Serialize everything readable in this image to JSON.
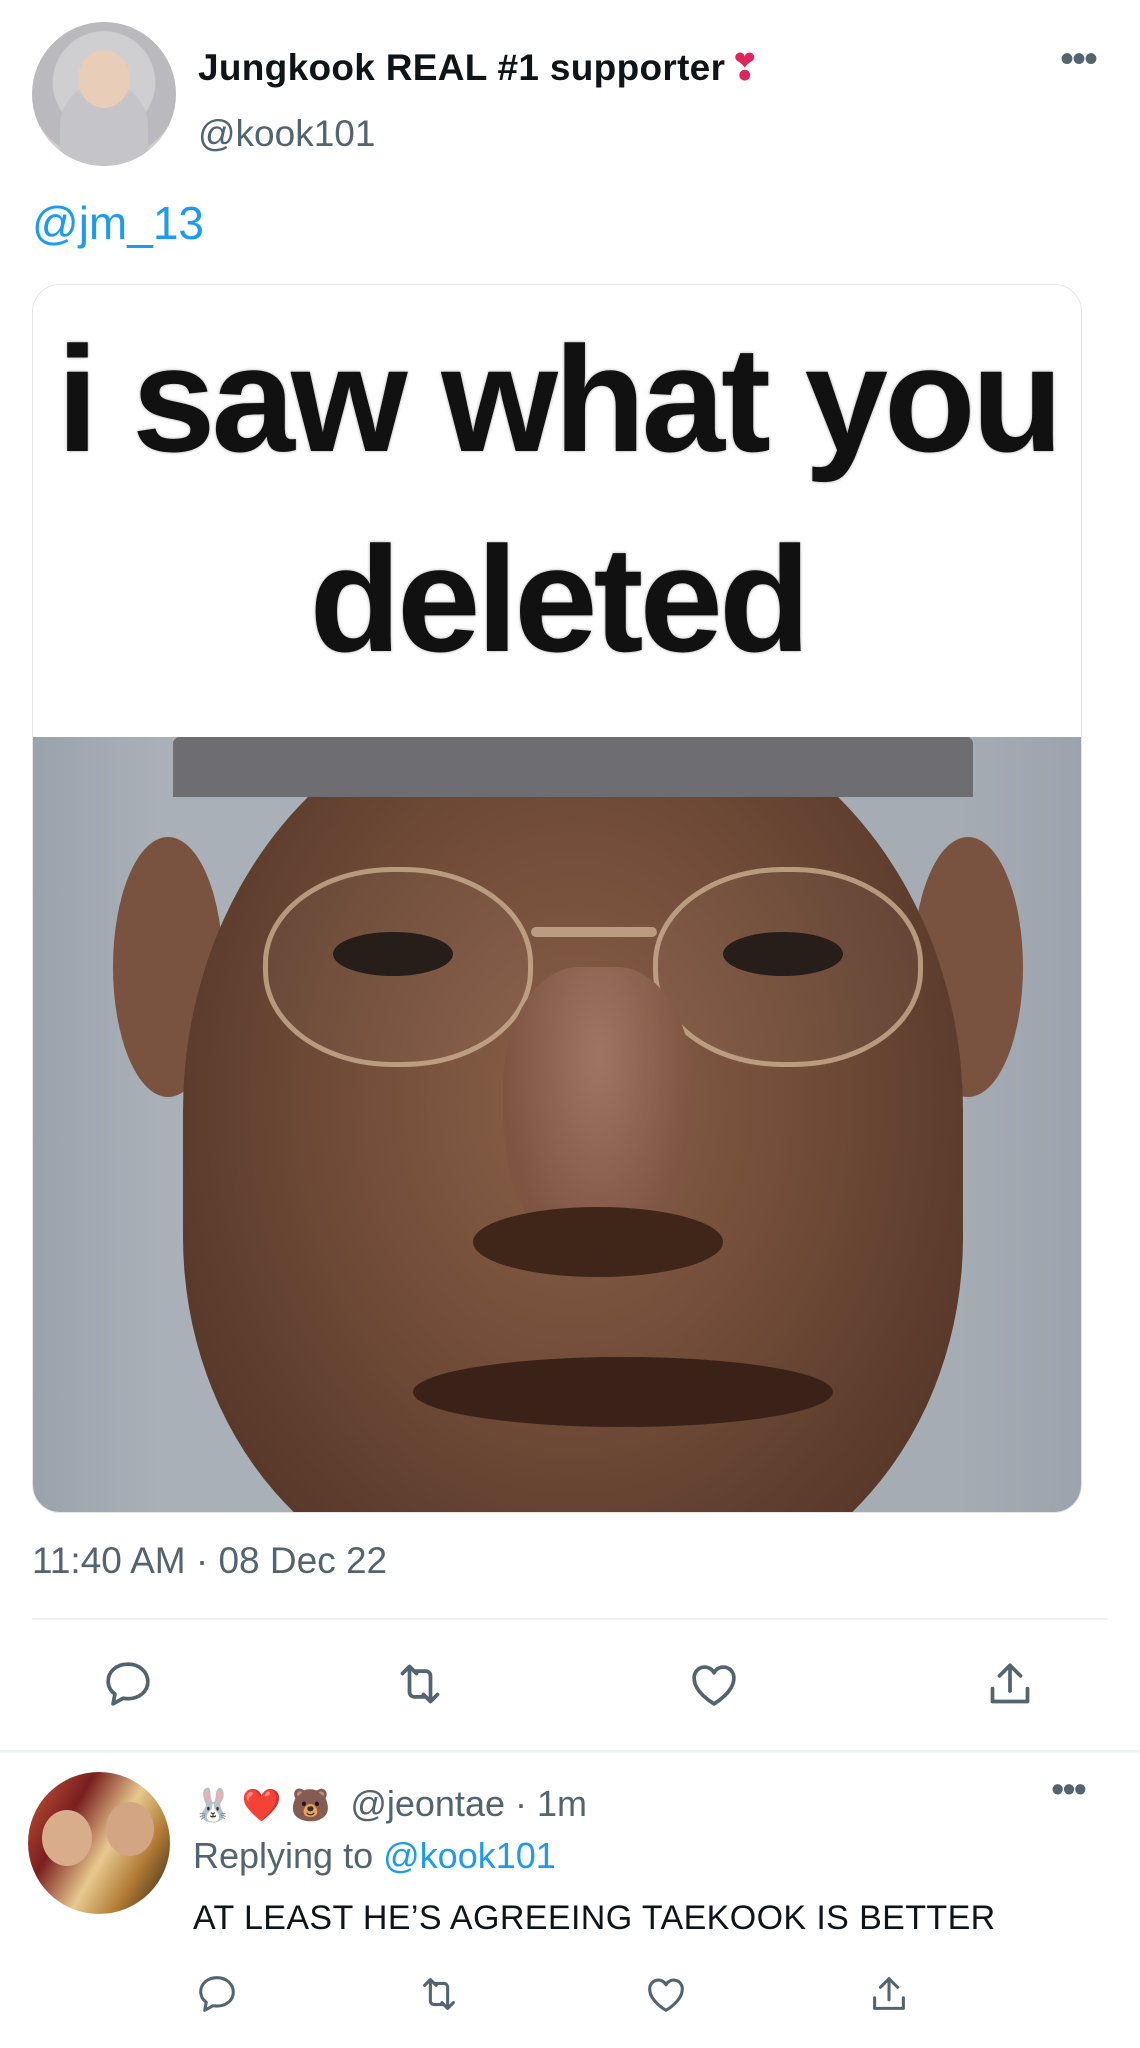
{
  "tweet": {
    "author": {
      "display_name": "Jungkook REAL #1 supporter",
      "name_emoji": "❣",
      "handle": "@kook101"
    },
    "more_icon": "more-horizontal-icon",
    "body_mention": "@jm_13",
    "media": {
      "caption": "i saw what you deleted",
      "caption_line1": "i saw what you",
      "caption_line2": "deleted"
    },
    "timestamp": "11:40 AM · 08 Dec 22",
    "actions": [
      "reply-icon",
      "retweet-icon",
      "like-icon",
      "share-icon"
    ]
  },
  "reply": {
    "author_emoji": "🐰 ❤️ 🐻",
    "handle": "@jeontae",
    "time": "· 1m",
    "replying_prefix": "Replying to",
    "replying_to": "@kook101",
    "text": "AT LEAST HE’S AGREEING TAEKOOK IS BETTER",
    "actions": [
      "reply-icon",
      "retweet-icon",
      "like-icon",
      "share-icon"
    ]
  },
  "colors": {
    "link": "#1d9bf0",
    "secondary_text": "#536471",
    "primary_text": "#0f1419",
    "divider": "#eff3f4"
  }
}
